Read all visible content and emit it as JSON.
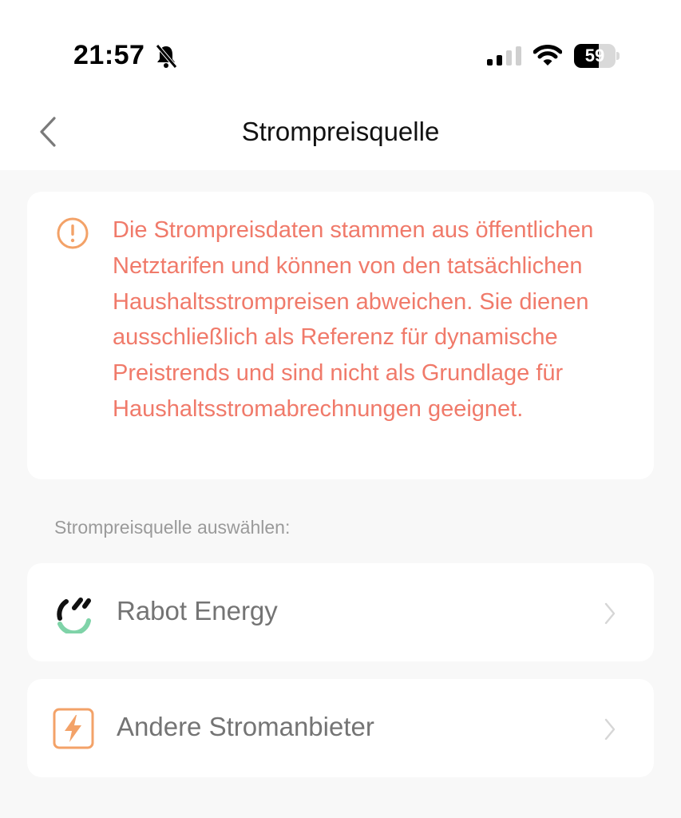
{
  "status_bar": {
    "time": "21:57",
    "battery_level": "59",
    "battery_fraction": 0.59,
    "icons": [
      "bell-slash-icon",
      "signal-icon",
      "wifi-icon",
      "battery-icon"
    ]
  },
  "nav": {
    "title": "Strompreisquelle",
    "back_icon": "chevron-left-icon"
  },
  "notice": {
    "icon": "exclamation-circle-icon",
    "text": "Die Strompreisdaten stammen aus öffentlichen Netztarifen und können von den tatsächlichen Haushaltsstrompreisen abweichen. Sie dienen ausschließlich als Referenz für dynamische Preistrends und sind nicht als Grundlage für Haushaltsstromabrechnungen geeignet."
  },
  "section_label": "Strompreisquelle auswählen:",
  "options": [
    {
      "label": "Rabot Energy",
      "icon": "rabot-energy-logo"
    },
    {
      "label": "Andere Stromanbieter",
      "icon": "lightning-bolt-icon"
    }
  ],
  "colors": {
    "accent_orange": "#f3a268",
    "notice_text": "#f07a6a",
    "rabot_green": "#7fd3a8"
  }
}
